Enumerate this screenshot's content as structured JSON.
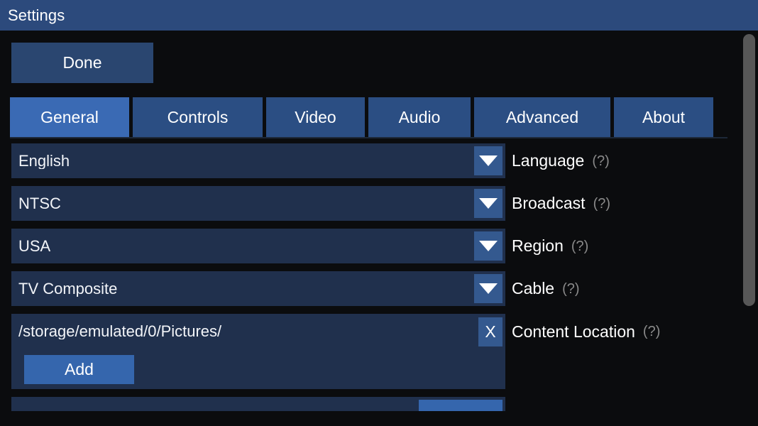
{
  "window": {
    "title": "Settings"
  },
  "toolbar": {
    "done_label": "Done"
  },
  "tabs": [
    {
      "label": "General",
      "active": true
    },
    {
      "label": "Controls",
      "active": false
    },
    {
      "label": "Video",
      "active": false
    },
    {
      "label": "Audio",
      "active": false
    },
    {
      "label": "Advanced",
      "active": false
    },
    {
      "label": "About",
      "active": false
    }
  ],
  "settings_rows": [
    {
      "value": "English",
      "label": "Language",
      "help": "(?)",
      "control": "dropdown",
      "icon": "chevron-down-icon"
    },
    {
      "value": "NTSC",
      "label": "Broadcast",
      "help": "(?)",
      "control": "dropdown",
      "icon": "chevron-down-icon"
    },
    {
      "value": "USA",
      "label": "Region",
      "help": "(?)",
      "control": "dropdown",
      "icon": "chevron-down-icon"
    },
    {
      "value": "TV Composite",
      "label": "Cable",
      "help": "(?)",
      "control": "dropdown",
      "icon": "chevron-down-icon"
    }
  ],
  "content_location": {
    "value": "/storage/emulated/0/Pictures/",
    "label": "Content Location",
    "help": "(?)",
    "clear_label": "X",
    "clear_icon": "close-icon",
    "add_label": "Add"
  },
  "scrollbar": {
    "orientation": "vertical"
  },
  "colors": {
    "titlebar": "#2c4a7c",
    "background": "#0b0c0e",
    "tab_active": "#3a6ab4",
    "tab_inactive": "#2b4e83",
    "field": "#20304d",
    "accent_button": "#3566ad",
    "drop_button": "#34598f",
    "done_button": "#2a4670",
    "text": "#ffffff",
    "help_text": "#8a8a8a",
    "scroll_thumb": "#575757"
  }
}
